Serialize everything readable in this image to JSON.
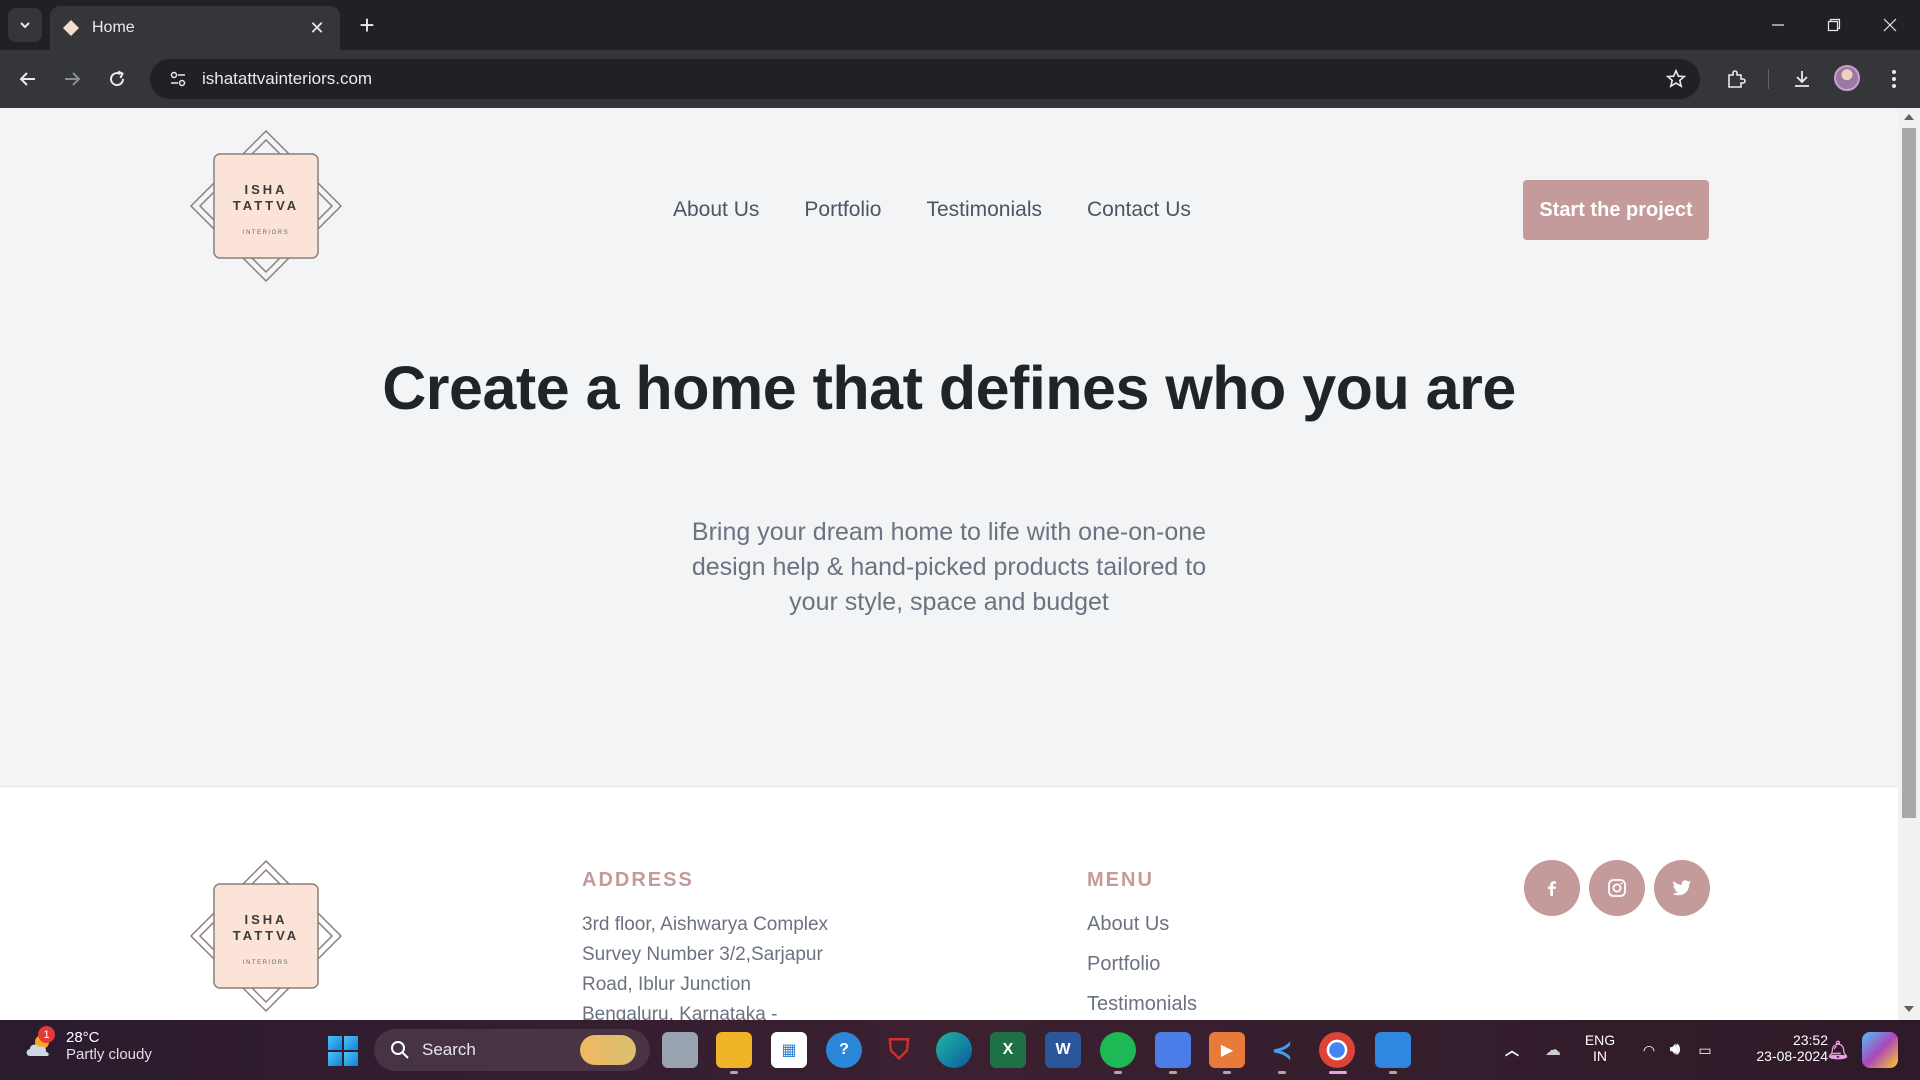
{
  "browser": {
    "tab_title": "Home",
    "url": "ishatattvainteriors.com"
  },
  "site": {
    "logo_line1": "ISHA",
    "logo_line2": "TATTVA",
    "logo_line3": "INTERIORS",
    "nav": [
      "About Us",
      "Portfolio",
      "Testimonials",
      "Contact Us"
    ],
    "cta_label": "Start the project",
    "hero_title": "Create a home that defines who you are",
    "hero_sub_lines": [
      "Bring your dream home to life with one-on-one",
      "design help & hand-picked products tailored to",
      "your style, space and budget"
    ],
    "accent_color": "#c49a9a",
    "logo_fill": "#fbe3d7",
    "footer": {
      "address_heading": "ADDRESS",
      "address_lines": [
        "3rd floor, Aishwarya Complex",
        "Survey Number 3/2,Sarjapur",
        "Road, Iblur Junction",
        "Bengaluru, Karnataka -"
      ],
      "menu_heading": "MENU",
      "menu_links": [
        "About Us",
        "Portfolio",
        "Testimonials"
      ],
      "social": [
        "facebook-icon",
        "instagram-icon",
        "twitter-icon"
      ],
      "social_glyphs": [
        "f",
        "◎",
        "🐦"
      ]
    }
  },
  "taskbar": {
    "weather_badge": "1",
    "weather_temp": "28°C",
    "weather_desc": "Partly cloudy",
    "search_label": "Search",
    "lang_line1": "ENG",
    "lang_line2": "IN",
    "time": "23:52",
    "date": "23-08-2024"
  }
}
